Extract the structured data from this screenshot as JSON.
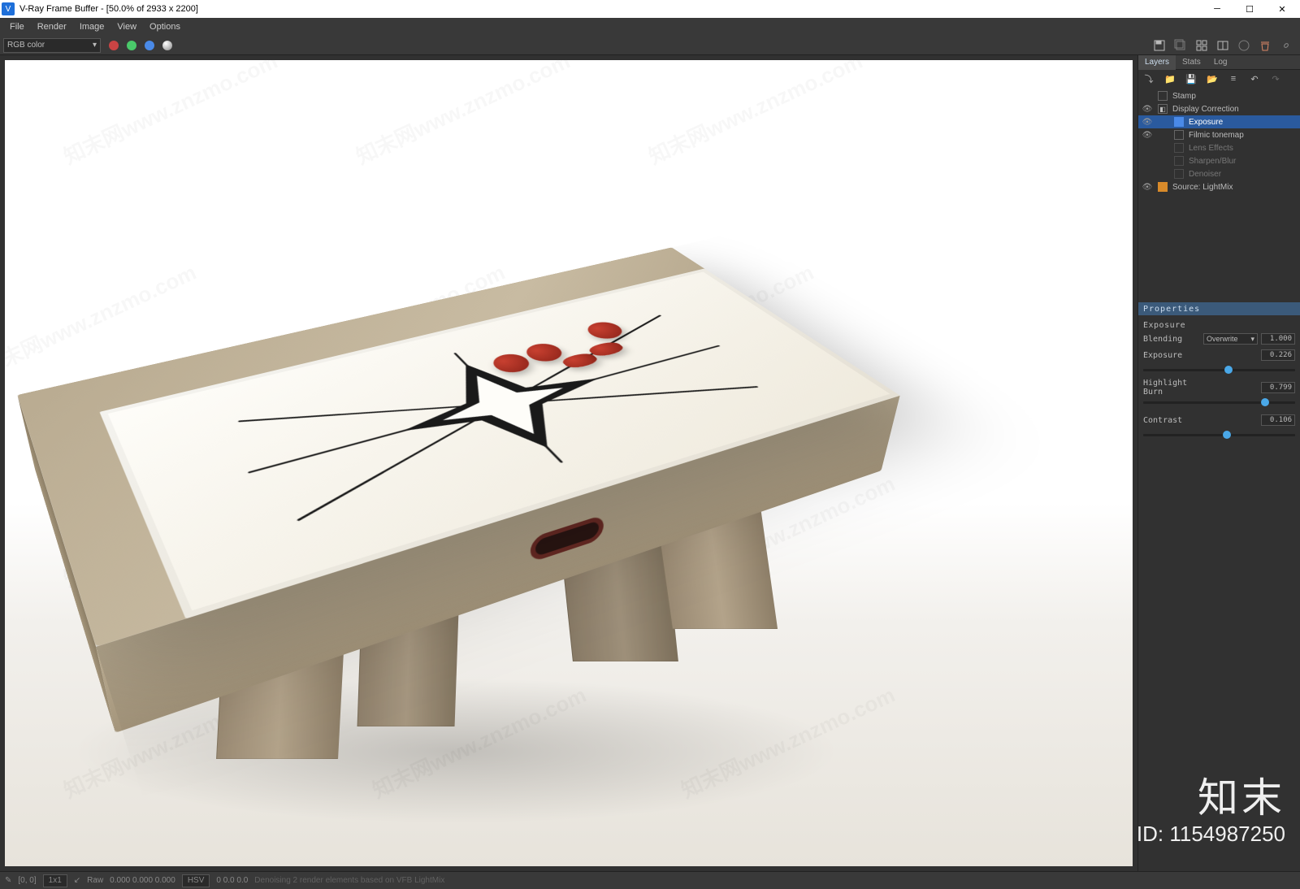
{
  "title": "V-Ray Frame Buffer - [50.0% of 2933 x 2200]",
  "menu": {
    "file": "File",
    "render": "Render",
    "image": "Image",
    "view": "View",
    "options": "Options"
  },
  "toolbar": {
    "channel": "RGB color"
  },
  "panel": {
    "tabs": {
      "layers": "Layers",
      "stats": "Stats",
      "log": "Log"
    },
    "layers": {
      "stamp": "Stamp",
      "display_correction": "Display Correction",
      "exposure": "Exposure",
      "filmic": "Filmic tonemap",
      "lens": "Lens Effects",
      "sharpen": "Sharpen/Blur",
      "denoiser": "Denoiser",
      "source": "Source: LightMix"
    },
    "props": {
      "header": "Properties",
      "group": "Exposure",
      "blending_label": "Blending",
      "blending_value": "Overwrite",
      "blending_num": "1.000",
      "exposure_label": "Exposure",
      "exposure_value": "0.226",
      "highlight_label": "Highlight Burn",
      "highlight_value": "0.799",
      "contrast_label": "Contrast",
      "contrast_value": "0.106"
    }
  },
  "status": {
    "coords": "[0, 0]",
    "zoom": "1x1",
    "raw": "Raw",
    "raw_vals": "0.000   0.000   0.000",
    "hsv": "HSV",
    "hsv_vals": "0     0.0   0.0",
    "msg": "Denoising 2 render elements based on VFB LightMix"
  },
  "watermark": {
    "text": "知末网www.znzmo.com",
    "brand": "知末",
    "id": "ID: 1154987250"
  }
}
